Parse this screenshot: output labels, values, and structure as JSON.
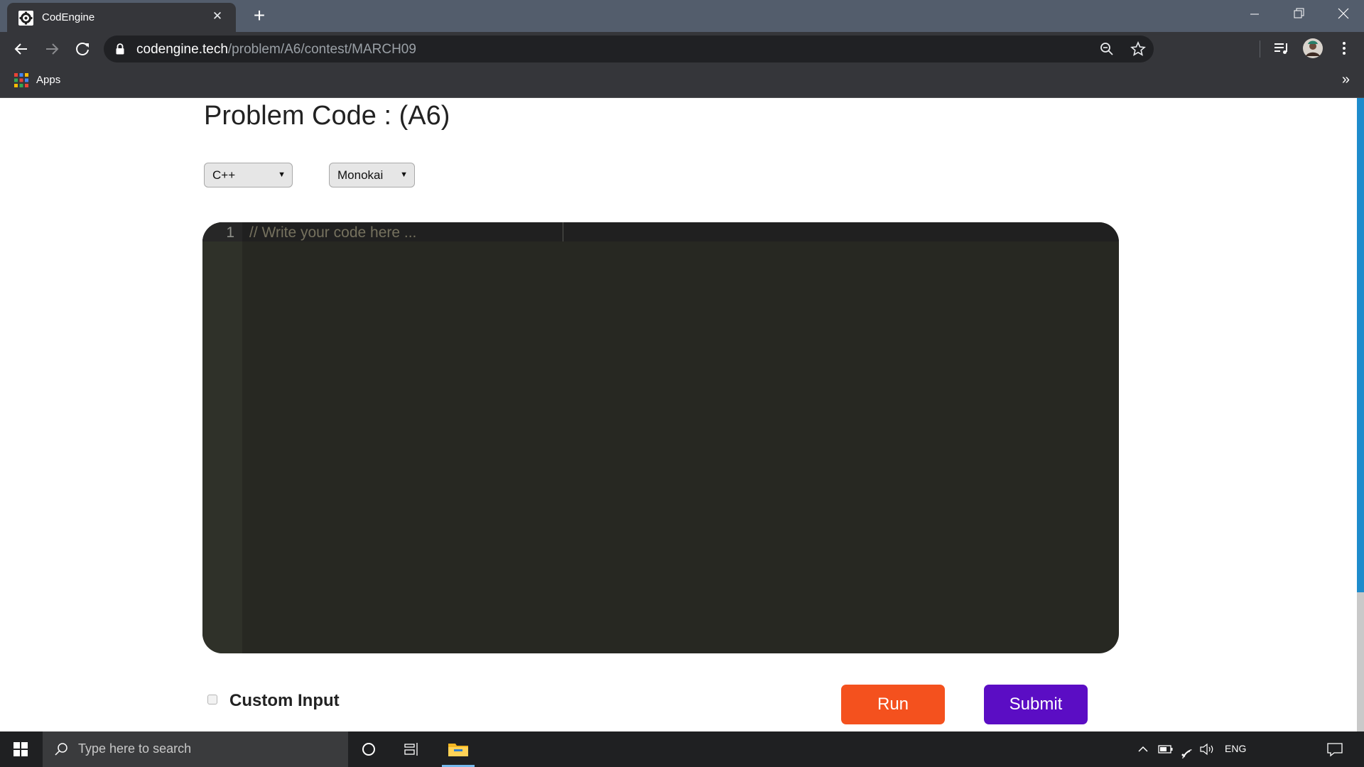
{
  "browser": {
    "tab_title": "CodEngine",
    "url_host": "codengine.tech",
    "url_path": "/problem/A6/contest/MARCH09",
    "bookmarks": {
      "apps_label": "Apps",
      "more": "»"
    }
  },
  "page": {
    "title": "Problem Code : (A6)",
    "language_select": {
      "selected": "C++"
    },
    "theme_select": {
      "selected": "Monokai"
    },
    "editor": {
      "line_number": "1",
      "placeholder": "// Write your code here ..."
    },
    "custom_input": {
      "label": "Custom Input",
      "checked": false
    },
    "run_label": "Run",
    "submit_label": "Submit"
  },
  "taskbar": {
    "search_placeholder": "Type here to search",
    "language": "ENG"
  },
  "colors": {
    "run": "#f4511e",
    "submit": "#5b0dc4",
    "editor_bg": "#272822",
    "accent_scrollbar": "#1e8ccc"
  },
  "icons": [
    "codengine-favicon",
    "close-icon",
    "plus-icon",
    "minimize-icon",
    "restore-icon",
    "window-close-icon",
    "back-icon",
    "forward-icon",
    "reload-icon",
    "lock-icon",
    "zoom-icon",
    "star-icon",
    "media-control-icon",
    "profile-avatar",
    "menu-icon",
    "apps-grid-icon",
    "windows-start-icon",
    "search-icon",
    "cortana-icon",
    "task-view-icon",
    "file-explorer-icon",
    "chevron-up-icon",
    "battery-icon",
    "wifi-icon",
    "volume-icon",
    "notification-icon"
  ]
}
